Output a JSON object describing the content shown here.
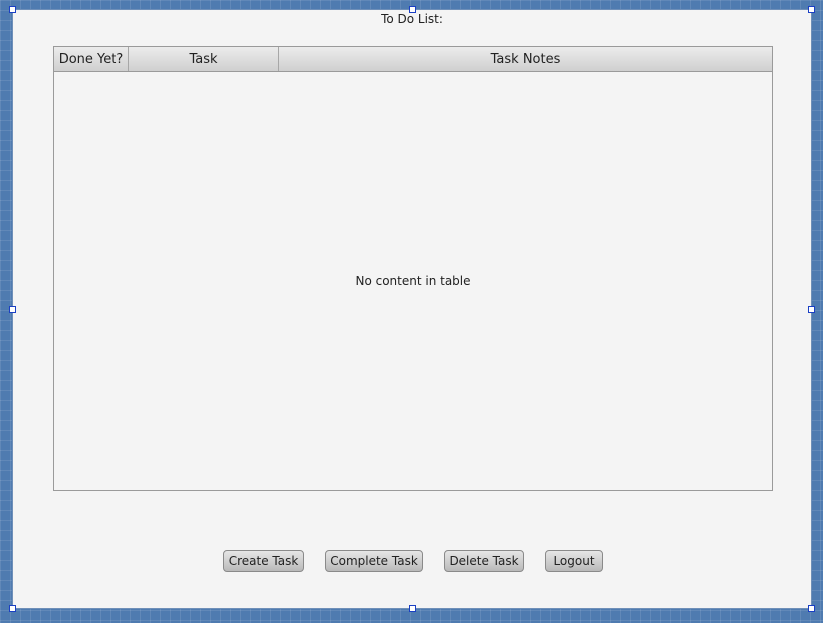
{
  "window": {
    "title": "To Do List:"
  },
  "table": {
    "columns": [
      "Done Yet?",
      "Task",
      "Task Notes"
    ],
    "empty_message": "No content in table"
  },
  "buttons": {
    "create": "Create Task",
    "complete": "Complete Task",
    "delete": "Delete Task",
    "logout": "Logout"
  }
}
